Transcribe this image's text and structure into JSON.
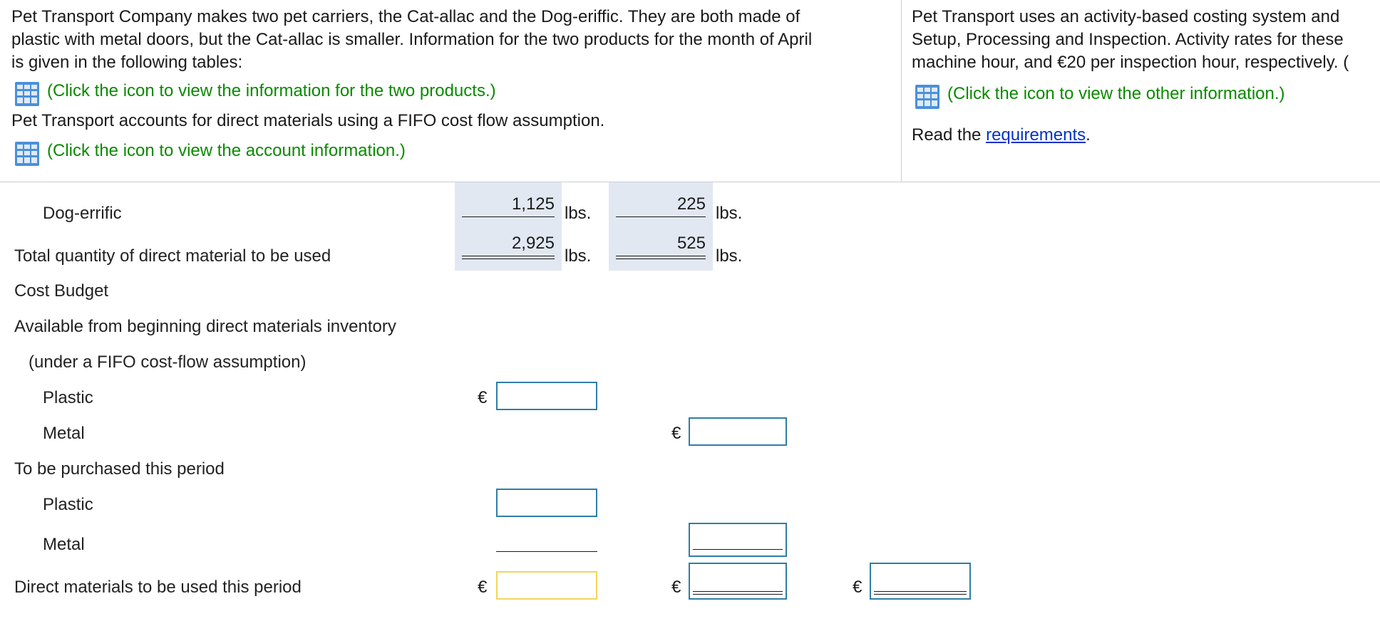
{
  "intro": {
    "line1": "Pet Transport Company makes two pet carriers, the Cat-allac and the Dog-eriffic. They are both made of",
    "line2": "plastic with metal doors, but the Cat-allac is smaller. Information for the two products for the month of April",
    "line3": "is given in the following tables:",
    "link_products": "(Click the icon to view the information for the two products.)",
    "fifo_text": "Pet Transport accounts for direct materials using a FIFO cost flow assumption.",
    "link_account": "(Click the icon to view the account information.)"
  },
  "right_panel": {
    "line1": "Pet Transport uses an activity-based costing system and",
    "line2": "Setup, Processing and Inspection. Activity rates for these",
    "line3": "machine hour, and €20 per inspection hour, respectively. (",
    "link_other": "(Click the icon to view the other information.)",
    "read_prefix": "Read the ",
    "requirements_link": "requirements",
    "read_suffix": "."
  },
  "colors": {
    "green_link": "#0a8a00",
    "blue_link": "#0033cc",
    "input_border": "#2e7ea6",
    "input_active_border": "#f3d55b",
    "shade": "#e2e8f2"
  },
  "icons": {
    "table_icon": "spreadsheet-grid"
  },
  "table": {
    "rows": {
      "dog_errific": "Dog-errific",
      "total_qty": "Total quantity of direct material to be used",
      "cost_budget": "Cost Budget",
      "available_begin": "Available from beginning direct materials inventory",
      "fifo_note": "(under a FIFO cost-flow assumption)",
      "plastic1": "Plastic",
      "metal1": "Metal",
      "to_purchase": "To be purchased this period",
      "plastic2": "Plastic",
      "metal2": "Metal",
      "dm_used": "Direct materials to be used this period"
    },
    "dog_plastic": "1,125",
    "dog_metal": "225",
    "total_plastic": "2,925",
    "total_metal": "525",
    "unit": "lbs.",
    "currency": "€"
  }
}
